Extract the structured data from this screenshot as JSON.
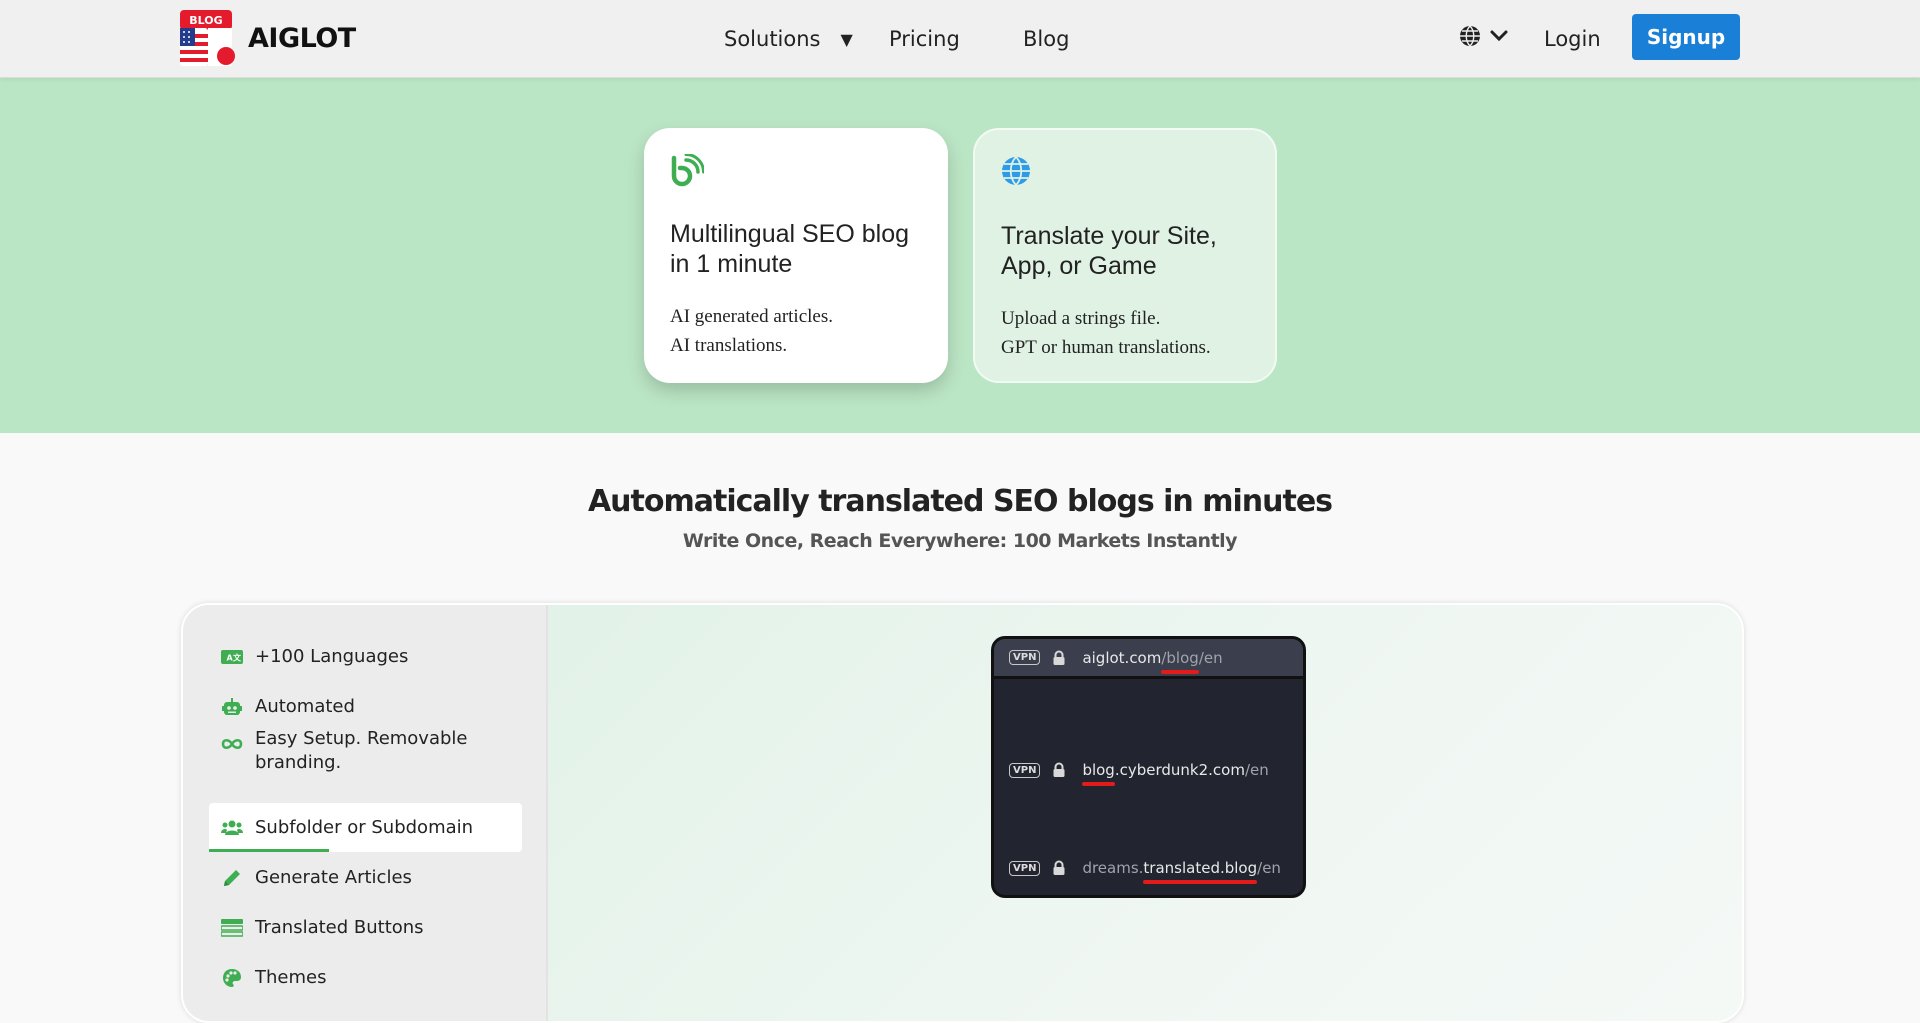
{
  "header": {
    "logo_badge": "BLOG",
    "logo_text": "AIGLOT",
    "nav": {
      "solutions": "Solutions",
      "solutions_caret": "▼",
      "pricing": "Pricing",
      "blog": "Blog"
    },
    "login": "Login",
    "signup": "Signup"
  },
  "hero": {
    "cards": [
      {
        "icon": "blog-icon",
        "title": "Multilingual SEO blog in 1 minute",
        "desc_line1": "AI generated articles.",
        "desc_line2": "AI translations."
      },
      {
        "icon": "globe-icon",
        "title": "Translate your Site, App, or Game",
        "desc_line1": "Upload a strings file.",
        "desc_line2": "GPT or human translations."
      }
    ]
  },
  "section": {
    "title": "Automatically translated SEO blogs in minutes",
    "subtitle": "Write Once, Reach Everywhere: 100 Markets Instantly"
  },
  "features": [
    {
      "label": "+100 Languages",
      "icon": "translate-icon"
    },
    {
      "label": "Automated",
      "icon": "robot-icon"
    },
    {
      "label": "Easy Setup. Removable branding.",
      "icon": "infinity-icon"
    },
    {
      "label": "Subfolder or Subdomain",
      "icon": "users-icon",
      "active": true
    },
    {
      "label": "Generate Articles",
      "icon": "pencil-icon"
    },
    {
      "label": "Translated Buttons",
      "icon": "buttons-icon"
    },
    {
      "label": "Themes",
      "icon": "palette-icon"
    }
  ],
  "preview": {
    "vpn_label": "VPN",
    "urls": [
      {
        "a": "aiglot.com",
        "b": "/blog",
        "c": "/en"
      },
      {
        "a": "blog",
        "b": ".cyberdunk2.com",
        "c": "/en"
      },
      {
        "a": "dreams.",
        "b": "translated.blog",
        "c": "/en"
      }
    ]
  },
  "colors": {
    "accent_green": "#3fae52",
    "hero_bg": "#bbe6c5",
    "signup_blue": "#1a7fd6",
    "underline_red": "#e31b1b"
  }
}
